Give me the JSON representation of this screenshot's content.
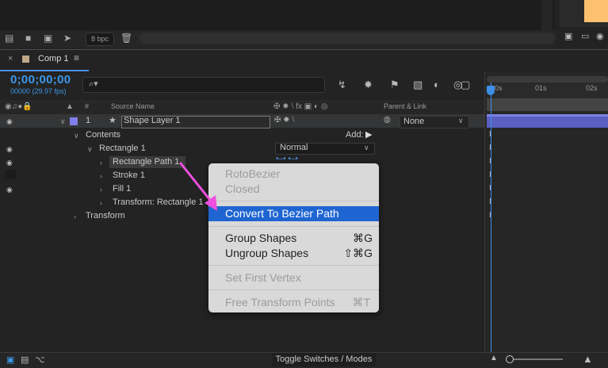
{
  "project": {
    "bpc": "8 bpc"
  },
  "comp": {
    "tab_title": "Comp 1",
    "timecode": "0;00;00;00",
    "fps": "00000 (29.97 fps)",
    "search_placeholder": "⌕▾"
  },
  "columns": {
    "num": "#",
    "source_name": "Source Name",
    "parent_link": "Parent & Link"
  },
  "layers": {
    "number": "1",
    "name": "Shape Layer 1",
    "parent": "None",
    "contents_label": "Contents",
    "add_label": "Add:",
    "rectangle_group": "Rectangle 1",
    "blend_mode": "Normal",
    "path": "Rectangle Path 1",
    "stroke": "Stroke 1",
    "fill": "Fill 1",
    "transform_rect": "Transform: Rectangle 1",
    "transform": "Transform"
  },
  "timeline": {
    "ruler": [
      "0s",
      "01s",
      "02s"
    ]
  },
  "bottom": {
    "toggle_label": "Toggle Switches / Modes"
  },
  "context_menu": {
    "items": [
      {
        "label": "RotoBezier",
        "shortcut": "",
        "enabled": false
      },
      {
        "label": "Closed",
        "shortcut": "",
        "enabled": false
      },
      {
        "label": "Convert To Bezier Path",
        "shortcut": "",
        "enabled": true,
        "highlighted": true
      },
      {
        "label": "Group Shapes",
        "shortcut": "⌘G",
        "enabled": true
      },
      {
        "label": "Ungroup Shapes",
        "shortcut": "⇧⌘G",
        "enabled": true
      },
      {
        "label": "Set First Vertex",
        "shortcut": "",
        "enabled": false
      },
      {
        "label": "Free Transform Points",
        "shortcut": "⌘T",
        "enabled": false
      }
    ]
  },
  "colors": {
    "accent_blue": "#3c97e8",
    "menu_highlight": "#1f65d2",
    "layer_color": "#7f7fe9",
    "annotation_arrow": "#ee4fe0"
  }
}
